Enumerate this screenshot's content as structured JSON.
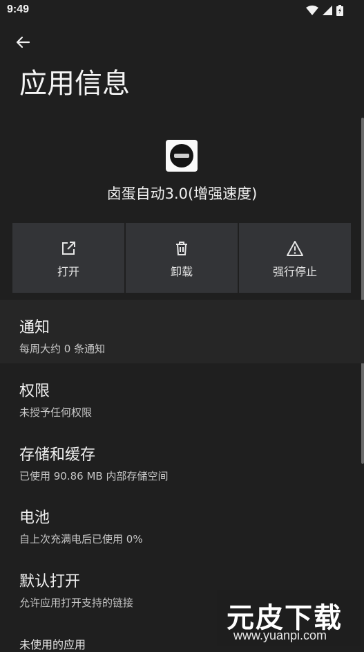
{
  "status_bar": {
    "time": "9:49",
    "icons": [
      "wifi-icon",
      "signal-icon",
      "battery-icon"
    ]
  },
  "header": {
    "back_icon": "arrow-left-icon",
    "title": "应用信息"
  },
  "app": {
    "name": "卤蛋自动3.0(增强速度)"
  },
  "actions": [
    {
      "label": "打开",
      "icon": "open-external-icon"
    },
    {
      "label": "卸载",
      "icon": "trash-icon"
    },
    {
      "label": "强行停止",
      "icon": "warning-icon"
    }
  ],
  "settings": [
    {
      "title": "通知",
      "subtitle": "每周大约 0 条通知"
    },
    {
      "title": "权限",
      "subtitle": "未授予任何权限"
    },
    {
      "title": "存储和缓存",
      "subtitle": "已使用 90.86 MB 内部存储空间"
    },
    {
      "title": "电池",
      "subtitle": "自上次充满电后已使用 0%"
    },
    {
      "title": "默认打开",
      "subtitle": "允许应用打开支持的链接"
    }
  ],
  "partial_item": "未使用的应用",
  "watermark": {
    "brand": "元皮下载",
    "url": "www.yuanpi.com"
  },
  "colors": {
    "background": "#1f1f1f",
    "card": "#333437",
    "accent_green": "#2fb54a"
  }
}
